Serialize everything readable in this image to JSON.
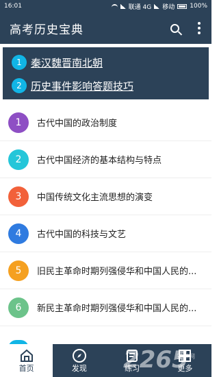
{
  "status": {
    "time": "16:01",
    "network": "联通 4G",
    "network2": "移动",
    "battery": "100%"
  },
  "app": {
    "title": "高考历史宝典"
  },
  "featured": [
    {
      "num": "1",
      "text": "秦汉魏晋南北朝"
    },
    {
      "num": "2",
      "text": "历史事件影响答题技巧"
    }
  ],
  "list": [
    {
      "num": "1",
      "text": "古代中国的政治制度",
      "color": "#8e4fc4"
    },
    {
      "num": "2",
      "text": "古代中国经济的基本结构与特点",
      "color": "#25c6d9"
    },
    {
      "num": "3",
      "text": "中国传统文化主流思想的演变",
      "color": "#f2613a"
    },
    {
      "num": "4",
      "text": "古代中国的科技与文艺",
      "color": "#2f7be0"
    },
    {
      "num": "5",
      "text": "旧民主革命时期列强侵华和中国人民的...",
      "color": "#f5a020"
    },
    {
      "num": "6",
      "text": "新民主革命时期列强侵华和中国人民的...",
      "color": "#6cc38a"
    }
  ],
  "tabs": [
    {
      "label": "首页",
      "icon": "home-icon"
    },
    {
      "label": "发现",
      "icon": "compass-icon"
    },
    {
      "label": "练习",
      "icon": "notes-icon"
    },
    {
      "label": "更多",
      "icon": "grid-icon"
    }
  ],
  "watermark": {
    "text": "2265",
    "sub": "安卓网"
  },
  "colors": {
    "primary": "#2c4258",
    "accent": "#11b5e6"
  }
}
